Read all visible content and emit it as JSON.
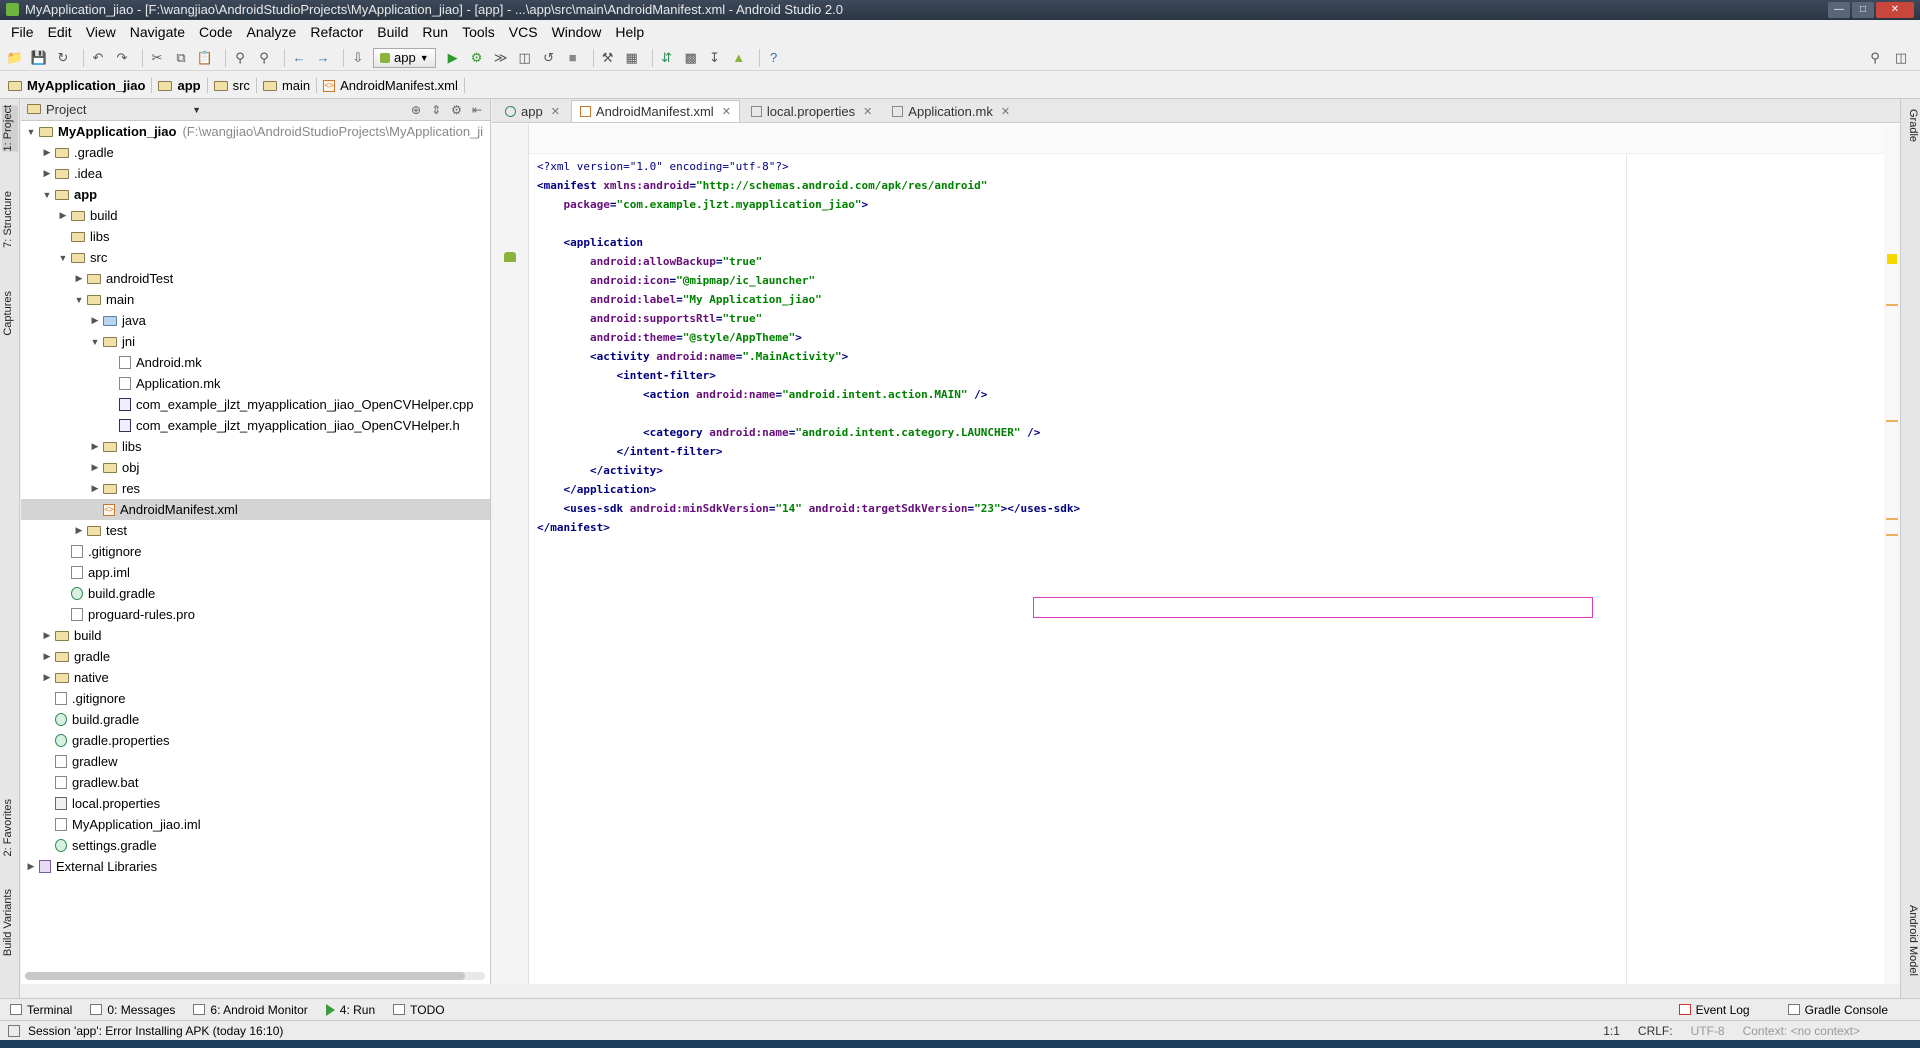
{
  "window": {
    "title": "MyApplication_jiao - [F:\\wangjiao\\AndroidStudioProjects\\MyApplication_jiao] - [app] - ...\\app\\src\\main\\AndroidManifest.xml - Android Studio 2.0"
  },
  "menu": [
    "File",
    "Edit",
    "View",
    "Navigate",
    "Code",
    "Analyze",
    "Refactor",
    "Build",
    "Run",
    "Tools",
    "VCS",
    "Window",
    "Help"
  ],
  "toolbar": {
    "run_config": "app"
  },
  "breadcrumb": [
    "MyApplication_jiao",
    "app",
    "src",
    "main",
    "AndroidManifest.xml"
  ],
  "left_stripe": {
    "project": "1: Project",
    "structure": "7: Structure",
    "captures": "Captures",
    "favorites": "2: Favorites",
    "build_variants": "Build Variants"
  },
  "right_stripe": {
    "gradle": "Gradle",
    "android_model": "Android Model"
  },
  "project_panel": {
    "view": "Project",
    "root_name": "MyApplication_jiao",
    "root_path": "(F:\\wangjiao\\AndroidStudioProjects\\MyApplication_ji"
  },
  "tree": [
    {
      "label": ".gradle",
      "level": 1,
      "arrow": "right",
      "icon": "folder"
    },
    {
      "label": ".idea",
      "level": 1,
      "arrow": "right",
      "icon": "folder"
    },
    {
      "label": "app",
      "level": 1,
      "arrow": "down",
      "icon": "folder",
      "bold": true
    },
    {
      "label": "build",
      "level": 2,
      "arrow": "right",
      "icon": "folder"
    },
    {
      "label": "libs",
      "level": 2,
      "arrow": "",
      "icon": "folder"
    },
    {
      "label": "src",
      "level": 2,
      "arrow": "down",
      "icon": "folder"
    },
    {
      "label": "androidTest",
      "level": 3,
      "arrow": "right",
      "icon": "folder"
    },
    {
      "label": "main",
      "level": 3,
      "arrow": "down",
      "icon": "folder"
    },
    {
      "label": "java",
      "level": 4,
      "arrow": "right",
      "icon": "folder-blue"
    },
    {
      "label": "jni",
      "level": 4,
      "arrow": "down",
      "icon": "folder"
    },
    {
      "label": "Android.mk",
      "level": 5,
      "arrow": "",
      "icon": "file"
    },
    {
      "label": "Application.mk",
      "level": 5,
      "arrow": "",
      "icon": "file"
    },
    {
      "label": "com_example_jlzt_myapplication_jiao_OpenCVHelper.cpp",
      "level": 5,
      "arrow": "",
      "icon": "cpp"
    },
    {
      "label": "com_example_jlzt_myapplication_jiao_OpenCVHelper.h",
      "level": 5,
      "arrow": "",
      "icon": "cpp"
    },
    {
      "label": "libs",
      "level": 4,
      "arrow": "right",
      "icon": "folder"
    },
    {
      "label": "obj",
      "level": 4,
      "arrow": "right",
      "icon": "folder"
    },
    {
      "label": "res",
      "level": 4,
      "arrow": "right",
      "icon": "folder"
    },
    {
      "label": "AndroidManifest.xml",
      "level": 4,
      "arrow": "",
      "icon": "xml",
      "selected": true
    },
    {
      "label": "test",
      "level": 3,
      "arrow": "right",
      "icon": "folder"
    },
    {
      "label": ".gitignore",
      "level": 2,
      "arrow": "",
      "icon": "file"
    },
    {
      "label": "app.iml",
      "level": 2,
      "arrow": "",
      "icon": "file"
    },
    {
      "label": "build.gradle",
      "level": 2,
      "arrow": "",
      "icon": "gradle"
    },
    {
      "label": "proguard-rules.pro",
      "level": 2,
      "arrow": "",
      "icon": "file"
    },
    {
      "label": "build",
      "level": 1,
      "arrow": "right",
      "icon": "folder"
    },
    {
      "label": "gradle",
      "level": 1,
      "arrow": "right",
      "icon": "folder"
    },
    {
      "label": "native",
      "level": 1,
      "arrow": "right",
      "icon": "folder"
    },
    {
      "label": ".gitignore",
      "level": 1,
      "arrow": "",
      "icon": "file"
    },
    {
      "label": "build.gradle",
      "level": 1,
      "arrow": "",
      "icon": "gradle"
    },
    {
      "label": "gradle.properties",
      "level": 1,
      "arrow": "",
      "icon": "gradle"
    },
    {
      "label": "gradlew",
      "level": 1,
      "arrow": "",
      "icon": "file"
    },
    {
      "label": "gradlew.bat",
      "level": 1,
      "arrow": "",
      "icon": "file"
    },
    {
      "label": "local.properties",
      "level": 1,
      "arrow": "",
      "icon": "props"
    },
    {
      "label": "MyApplication_jiao.iml",
      "level": 1,
      "arrow": "",
      "icon": "file"
    },
    {
      "label": "settings.gradle",
      "level": 1,
      "arrow": "",
      "icon": "gradle"
    },
    {
      "label": "External Libraries",
      "level": 0,
      "arrow": "right",
      "icon": "lib"
    }
  ],
  "editor_tabs": [
    {
      "label": "app",
      "active": false
    },
    {
      "label": "AndroidManifest.xml",
      "active": true
    },
    {
      "label": "local.properties",
      "active": false
    },
    {
      "label": "Application.mk",
      "active": false
    }
  ],
  "code_lines": [
    [
      [
        "pi",
        "<?xml version=\"1.0\" encoding=\"utf-8\"?>"
      ]
    ],
    [
      [
        "tag",
        "<manifest "
      ],
      [
        "attr",
        "xmlns:android"
      ],
      [
        "tag",
        "="
      ],
      [
        "val",
        "\"http://schemas.android.com/apk/res/android\""
      ]
    ],
    [
      [
        "txt",
        "    "
      ],
      [
        "attr",
        "package"
      ],
      [
        "tag",
        "="
      ],
      [
        "val",
        "\"com.example.jlzt.myapplication_jiao\""
      ],
      [
        "tag",
        ">"
      ]
    ],
    [],
    [
      [
        "txt",
        "    "
      ],
      [
        "tag",
        "<application"
      ]
    ],
    [
      [
        "txt",
        "        "
      ],
      [
        "attr",
        "android:allowBackup"
      ],
      [
        "tag",
        "="
      ],
      [
        "val",
        "\"true\""
      ]
    ],
    [
      [
        "txt",
        "        "
      ],
      [
        "attr",
        "android:icon"
      ],
      [
        "tag",
        "="
      ],
      [
        "val",
        "\"@mipmap/ic_launcher\""
      ]
    ],
    [
      [
        "txt",
        "        "
      ],
      [
        "attr",
        "android:label"
      ],
      [
        "tag",
        "="
      ],
      [
        "val",
        "\"My Application_jiao\""
      ]
    ],
    [
      [
        "txt",
        "        "
      ],
      [
        "attr",
        "android:supportsRtl"
      ],
      [
        "tag",
        "="
      ],
      [
        "val",
        "\"true\""
      ]
    ],
    [
      [
        "txt",
        "        "
      ],
      [
        "attr",
        "android:theme"
      ],
      [
        "tag",
        "="
      ],
      [
        "val",
        "\"@style/AppTheme\""
      ],
      [
        "tag",
        ">"
      ]
    ],
    [
      [
        "txt",
        "        "
      ],
      [
        "tag",
        "<activity "
      ],
      [
        "attr",
        "android:name"
      ],
      [
        "tag",
        "="
      ],
      [
        "val",
        "\".MainActivity\""
      ],
      [
        "tag",
        ">"
      ]
    ],
    [
      [
        "txt",
        "            "
      ],
      [
        "tag",
        "<intent-filter>"
      ]
    ],
    [
      [
        "txt",
        "                "
      ],
      [
        "tag",
        "<action "
      ],
      [
        "attr",
        "android:name"
      ],
      [
        "tag",
        "="
      ],
      [
        "val",
        "\"android.intent.action.MAIN\""
      ],
      [
        "tag",
        " />"
      ]
    ],
    [],
    [
      [
        "txt",
        "                "
      ],
      [
        "tag",
        "<category "
      ],
      [
        "attr",
        "android:name"
      ],
      [
        "tag",
        "="
      ],
      [
        "val",
        "\"android.intent.category.LAUNCHER\""
      ],
      [
        "tag",
        " />"
      ]
    ],
    [
      [
        "txt",
        "            "
      ],
      [
        "tag",
        "</intent-filter>"
      ]
    ],
    [
      [
        "txt",
        "        "
      ],
      [
        "tag",
        "</activity>"
      ]
    ],
    [
      [
        "txt",
        "    "
      ],
      [
        "tag",
        "</application>"
      ]
    ],
    [
      [
        "txt",
        "    "
      ],
      [
        "tag",
        "<uses-sdk "
      ],
      [
        "attr",
        "android:minSdkVersion"
      ],
      [
        "tag",
        "="
      ],
      [
        "val",
        "\"14\""
      ],
      [
        "txt",
        " "
      ],
      [
        "attr",
        "android:targetSdkVersion"
      ],
      [
        "tag",
        "="
      ],
      [
        "val",
        "\"23\""
      ],
      [
        "tag",
        "></uses-sdk>"
      ]
    ],
    [
      [
        "tag",
        "</manifest>"
      ]
    ]
  ],
  "bottom_tabs": [
    {
      "label": "Terminal",
      "icon": "terminal-icon"
    },
    {
      "label": "0: Messages",
      "icon": "messages-icon"
    },
    {
      "label": "6: Android Monitor",
      "icon": "android-icon"
    },
    {
      "label": "4: Run",
      "icon": "run-icon"
    },
    {
      "label": "TODO",
      "icon": "todo-icon"
    }
  ],
  "bottom_right": [
    "Event Log",
    "Gradle Console"
  ],
  "status": {
    "message": "Session 'app': Error Installing APK (today 16:10)",
    "position": "1:1",
    "line_sep": "CRLF:",
    "encoding": "UTF-8",
    "context": "Context: <no context>"
  },
  "colors": {
    "tag": "#000080",
    "attribute": "#660e7a",
    "value": "#008000",
    "selection": "#d4d4d4",
    "uses_sdk_highlight": "#e040c0"
  }
}
